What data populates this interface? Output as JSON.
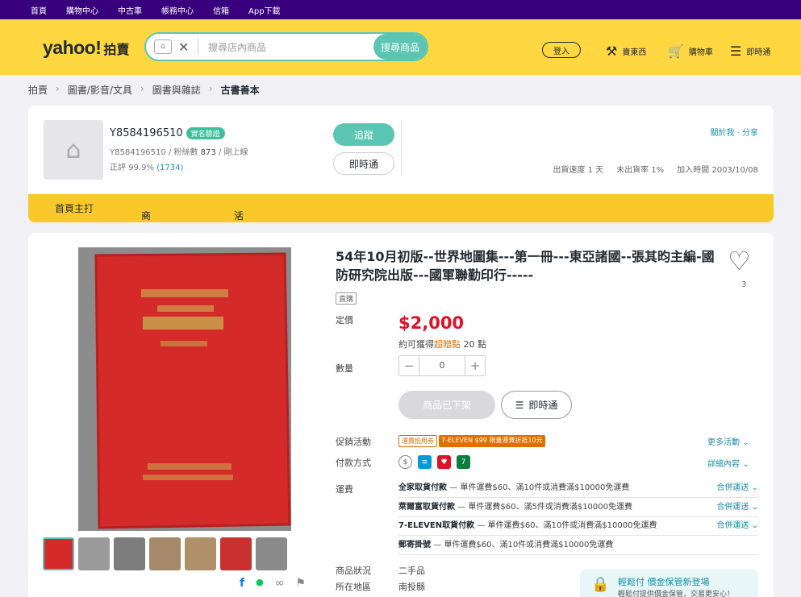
{
  "topbar": {
    "items": [
      "首頁",
      "購物中心",
      "中古車",
      "帳務中心",
      "信箱",
      "App下載"
    ]
  },
  "header": {
    "logo": "yahoo!",
    "logo_sub": "拍賣",
    "search_placeholder": "搜尋店內商品",
    "search_button": "搜尋商品",
    "login": "登入",
    "sell": "賣東西",
    "cart": "購物車",
    "chat": "即時通"
  },
  "breadcrumb": [
    "拍賣",
    "圖書/影音/文具",
    "圖書與雜誌",
    "古書善本"
  ],
  "store": {
    "name": "Y8584196510",
    "badge": "實名驗證",
    "id": "Y8584196510",
    "fans_label": "粉絲數",
    "fans": "873",
    "status": "剛上線",
    "rating_label": "正評",
    "rating": "99.9%",
    "rating_count": "(1734)",
    "follow": "追蹤",
    "chat": "即時通",
    "about": "關於我 · 分享",
    "ship_speed": "出貨速度  1 天",
    "no_ship_rate": "未出貨率  1%",
    "join": "加入時間  2003/10/08"
  },
  "store_nav": [
    "首頁主打",
    "商品分類",
    "活動優惠"
  ],
  "product": {
    "title": "54年10月初版--世界地圖集---第一冊---東亞諸國--張其昀主編-國防研究院出版---國軍聯勤印行-----",
    "likes": "3",
    "condition_tag": "直購",
    "price_label": "定價",
    "price": "$2,000",
    "points_pre": "約可獲得",
    "points_link": "超贈點",
    "points_post": "20 點",
    "qty_label": "數量",
    "qty": "0",
    "offshelf": "商品已下架",
    "chat": "即時通",
    "promo_label": "促銷活動",
    "promo_tag1": "運費抵用券",
    "promo_tag2": "7-ELEVEN $99 限量運費折抵10元",
    "promo_more": "更多活動",
    "pay_label": "付款方式",
    "pay_more": "詳細內容",
    "ship_label": "運費",
    "shipping": [
      {
        "name": "全家取貨付款",
        "desc": "— 單件運費$60、滿10件或消費滿$10000免運費",
        "more": "合併運送"
      },
      {
        "name": "萊爾富取貨付款",
        "desc": "— 單件運費$60、滿5件或消費滿$10000免運費",
        "more": "合併運送"
      },
      {
        "name": "7-ELEVEN取貨付款",
        "desc": "— 單件運費$60、滿10件或消費滿$10000免運費",
        "more": "合併運送"
      },
      {
        "name": "郵寄掛號",
        "desc": "— 單件運費$60、滿10件或消費滿$10000免運費",
        "more": ""
      }
    ],
    "item_status_label": "商品狀況",
    "item_status": "二手品",
    "location_label": "所在地區",
    "location": "南投縣",
    "paybox_title": "輕鬆付 價金保管新登場",
    "paybox_sub": "輕鬆付提供價金保管，交易更安心！"
  },
  "colors": {
    "brand": "#39007d",
    "header": "#ffd740",
    "accent": "#5bc5b3",
    "price": "#e0112b"
  }
}
